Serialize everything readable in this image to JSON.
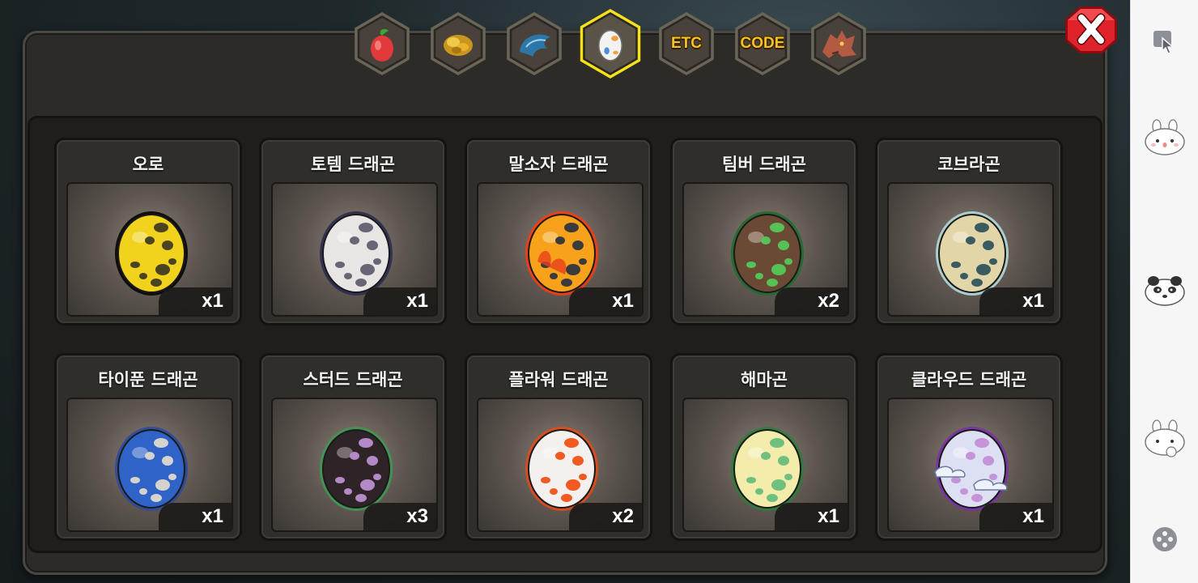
{
  "tabs": [
    {
      "name": "fruit",
      "icon": "fruit-icon",
      "label": "",
      "selected": false
    },
    {
      "name": "gold",
      "icon": "gold-icon",
      "label": "",
      "selected": false
    },
    {
      "name": "scale",
      "icon": "scale-icon",
      "label": "",
      "selected": false
    },
    {
      "name": "egg",
      "icon": "egg-icon",
      "label": "",
      "selected": true
    },
    {
      "name": "etc",
      "icon": "",
      "label": "ETC",
      "selected": false
    },
    {
      "name": "code",
      "icon": "",
      "label": "CODE",
      "selected": false
    },
    {
      "name": "dragon",
      "icon": "dragon-head-icon",
      "label": "",
      "selected": false
    }
  ],
  "eggs": [
    {
      "name": "오로",
      "count": "x1",
      "base": "#f1d21c",
      "spot": "#4a4520",
      "glow": "#000000"
    },
    {
      "name": "토템 드래곤",
      "count": "x1",
      "base": "#e8e6e4",
      "spot": "#6a6476",
      "glow": "#2a2950"
    },
    {
      "name": "말소자 드래곤",
      "count": "x1",
      "base": "#f7a21a",
      "spot": "#3b3b3b",
      "glow": "#ff3a10"
    },
    {
      "name": "팀버 드래곤",
      "count": "x2",
      "base": "#6b4a35",
      "spot": "#56c255",
      "glow": "#1e6b2e"
    },
    {
      "name": "코브라곤",
      "count": "x1",
      "base": "#e2d6a8",
      "spot": "#3a5c60",
      "glow": "#b8e0e0"
    },
    {
      "name": "타이푼 드래곤",
      "count": "x1",
      "base": "#2f63c8",
      "spot": "#d6d3cf",
      "glow": "#2a4aa0"
    },
    {
      "name": "스터드 드래곤",
      "count": "x3",
      "base": "#2e2326",
      "spot": "#b489c7",
      "glow": "#3e9a55"
    },
    {
      "name": "플라워 드래곤",
      "count": "x2",
      "base": "#f3f0ee",
      "spot": "#f25a22",
      "glow": "#e84a18"
    },
    {
      "name": "해마곤",
      "count": "x1",
      "base": "#f3ecaa",
      "spot": "#6fc07f",
      "glow": "#2e7d3a"
    },
    {
      "name": "클라우드 드래곤",
      "count": "x1",
      "base": "#dde0f3",
      "spot": "#c593d8",
      "glow": "#7a2fa8"
    }
  ],
  "colors": {
    "tab_gold": "#f3c224",
    "tab_selected_border": "#f7e21a",
    "close_red": "#e0222a"
  }
}
